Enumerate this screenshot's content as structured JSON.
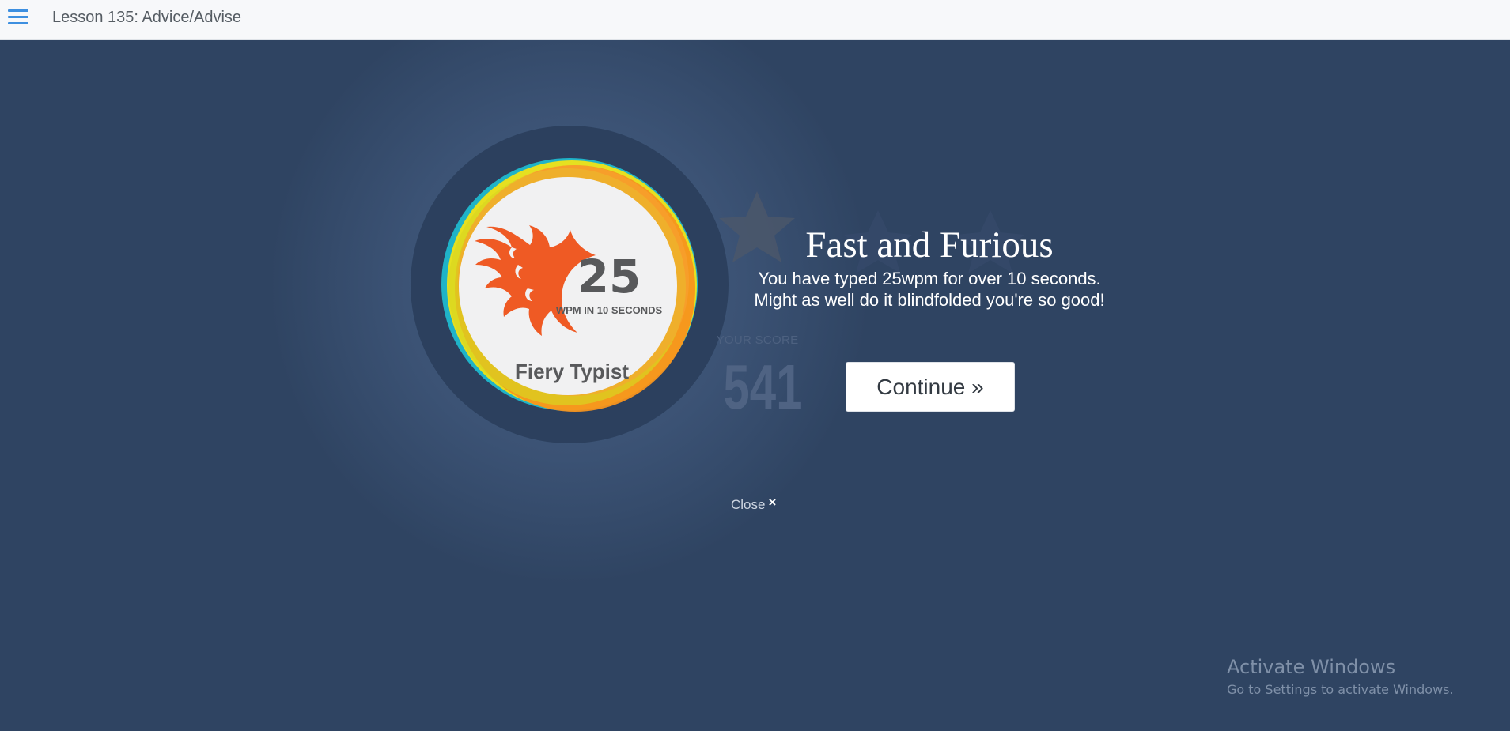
{
  "header": {
    "menu_icon": "hamburger-menu-icon",
    "lesson_title": "Lesson 135: Advice/Advise"
  },
  "badge": {
    "number": "25",
    "subtitle": "WPM IN 10 SECONDS",
    "name": "Fiery Typist",
    "icon": "flame-icon",
    "colors": {
      "flame": "#ef5a24",
      "ring_orange": "#f7941d",
      "ring_yellow": "#e6e020",
      "ring_teal": "#1fb3c8",
      "face": "#f1f1f2",
      "number": "#58595b"
    }
  },
  "stars": {
    "icon": "star-icon",
    "earned": 0,
    "total": 3
  },
  "score": {
    "label": "YOUR SCORE",
    "value": "541"
  },
  "achievement": {
    "title": "Fast and Furious",
    "description": "You have typed 25wpm for over 10 seconds. Might as well do it blindfolded you're so good!"
  },
  "actions": {
    "continue_label": "Continue »",
    "close_label": "Close",
    "close_icon": "×"
  },
  "watermark": {
    "title": "Activate Windows",
    "subtitle": "Go to Settings to activate Windows."
  },
  "colors": {
    "background": "#2f4462",
    "topbar": "#f7f8fa",
    "accent": "#3d8fe0"
  }
}
